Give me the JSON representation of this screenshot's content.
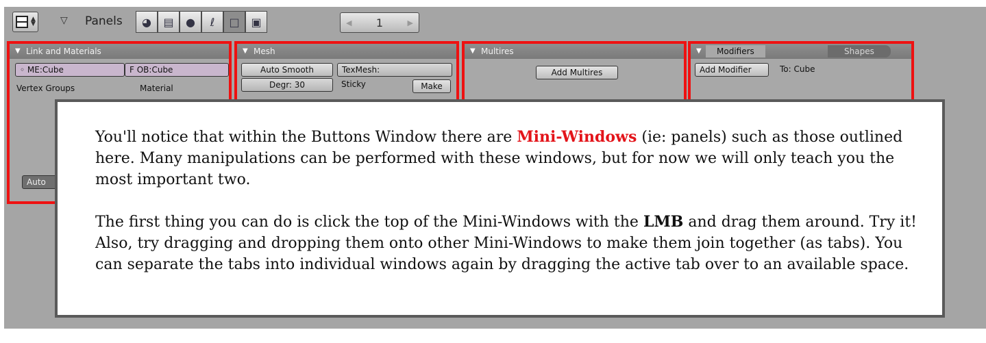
{
  "header": {
    "panels_label": "Panels",
    "page_number": "1",
    "icons": [
      "shading-icon",
      "object-icon",
      "material-sphere-icon",
      "physics-icon",
      "editing-icon",
      "scene-icon"
    ]
  },
  "panels": {
    "link_materials": {
      "title": "Link and Materials",
      "mesh_field": "ME:Cube",
      "f_label": "F",
      "object_field": "OB:Cube",
      "vertex_groups": "Vertex Groups",
      "material": "Material",
      "auto_clip": "Auto"
    },
    "mesh": {
      "title": "Mesh",
      "auto_smooth": "Auto Smooth",
      "texmesh": "TexMesh:",
      "degr": "Degr: 30",
      "sticky": "Sticky",
      "make": "Make"
    },
    "multires": {
      "title": "Multires",
      "add_multires": "Add Multires"
    },
    "modifiers": {
      "tab_modifiers": "Modifiers",
      "tab_shapes": "Shapes",
      "add_modifier": "Add Modifier",
      "to": "To: Cube"
    }
  },
  "info": {
    "p1_before": "You'll notice that within the Buttons Window there are ",
    "p1_highlight": "Mini-Windows",
    "p1_after": " (ie: panels) such as those outlined here. Many manipulations can be performed with these windows, but for now we will only teach you the most important two.",
    "p2_before": "The first thing you can do is click the top of the Mini-Windows with the ",
    "p2_bold": "LMB",
    "p2_after": " and drag them around. Try it! Also, try dragging and dropping them onto other Mini-Windows to make them join together (as tabs). You can separate the tabs into individual windows again by dragging the active tab over to an available space."
  },
  "colors": {
    "highlight_outline": "#ee1111",
    "highlight_text": "#e3141a",
    "window_bg": "#a5a5a5"
  }
}
